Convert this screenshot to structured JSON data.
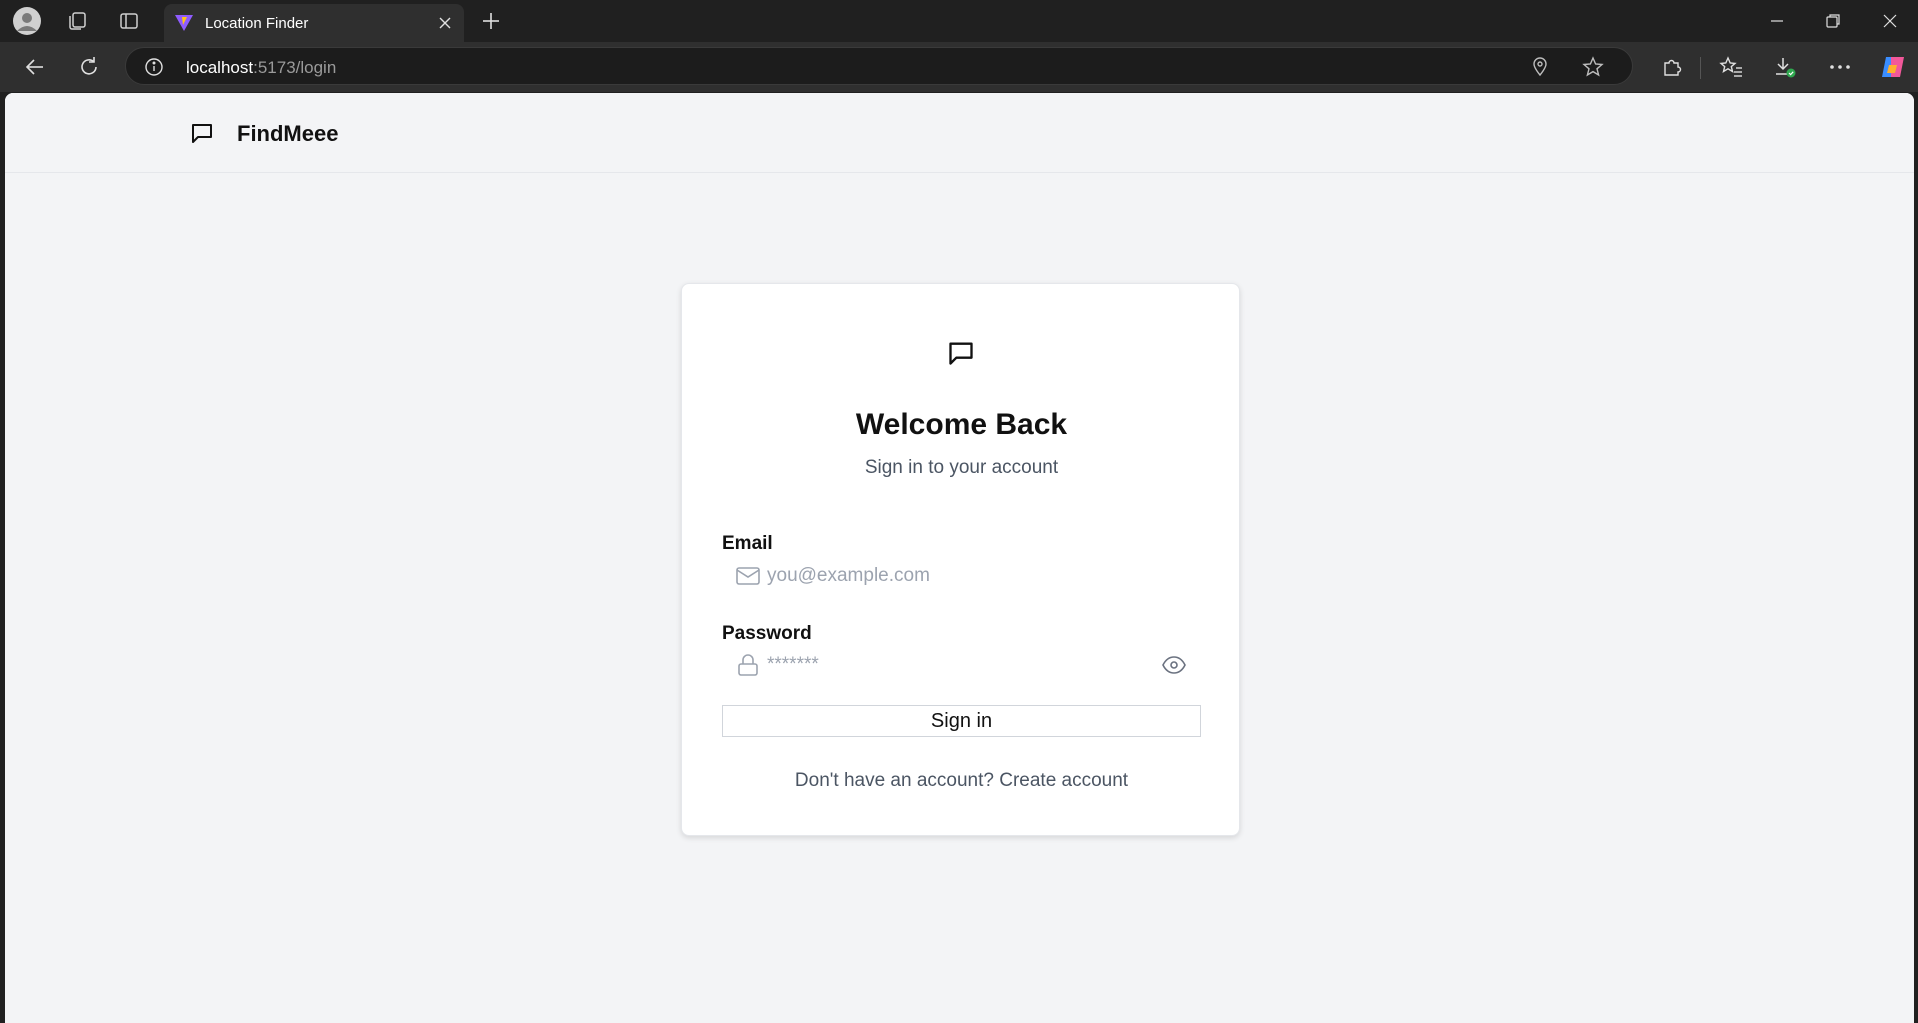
{
  "browser": {
    "tab_title": "Location Finder",
    "url_host": "localhost",
    "url_path": ":5173/login"
  },
  "app": {
    "brand_name": "FindMeee",
    "brand_icon": "message-square-icon"
  },
  "login": {
    "title": "Welcome Back",
    "subtitle": "Sign in to your account",
    "email_label": "Email",
    "email_placeholder": "you@example.com",
    "password_label": "Password",
    "password_placeholder": "*******",
    "signin_label": "Sign in",
    "register_prompt": "Don't have an account?",
    "register_link": "Create account"
  },
  "colors": {
    "page_bg": "#f3f4f6",
    "card_bg": "#ffffff",
    "muted_text": "#4b5563",
    "placeholder": "#9ca3af"
  }
}
